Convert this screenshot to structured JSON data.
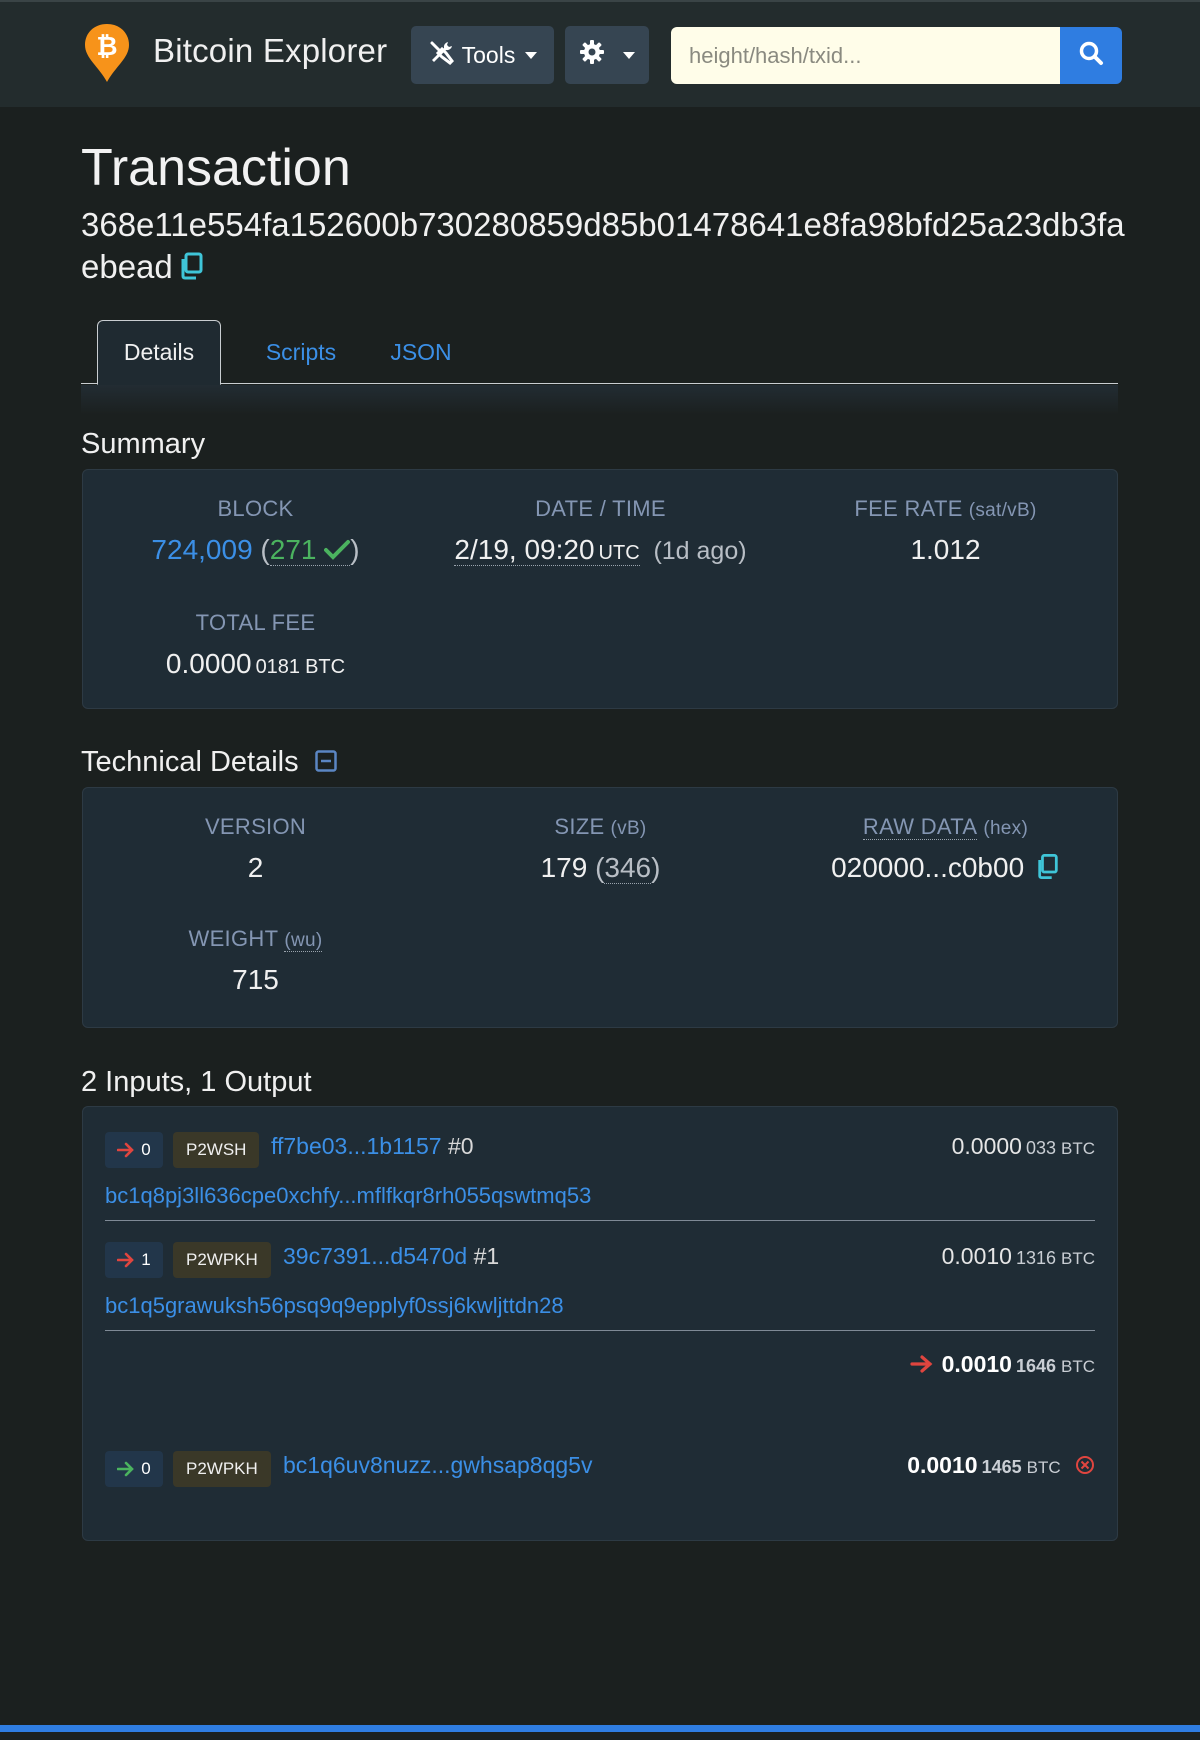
{
  "navbar": {
    "brand": "Bitcoin Explorer",
    "tools_label": "Tools",
    "search_placeholder": "height/hash/txid..."
  },
  "page": {
    "title": "Transaction",
    "txid": "368e11e554fa152600b730280859d85b01478641e8fa98bfd25a23db3faebead"
  },
  "tabs": [
    {
      "label": "Details",
      "active": true
    },
    {
      "label": "Scripts",
      "active": false
    },
    {
      "label": "JSON",
      "active": false
    }
  ],
  "summary": {
    "title": "Summary",
    "block_label": "BLOCK",
    "block_height": "724,009",
    "confirmations": "271",
    "datetime_label": "DATE / TIME",
    "datetime_value": "2/19, 09:20",
    "datetime_tz": "UTC",
    "datetime_ago": "(1d ago)",
    "fee_rate_label": "FEE RATE",
    "fee_rate_unit": "(sat/vB)",
    "fee_rate_value": "1.012",
    "total_fee_label": "TOTAL FEE",
    "total_fee_main": "0.0000",
    "total_fee_small": "0181",
    "total_fee_unit": "BTC"
  },
  "technical": {
    "title": "Technical Details",
    "version_label": "VERSION",
    "version_value": "2",
    "size_label": "SIZE",
    "size_unit": "(vB)",
    "size_value": "179",
    "size_raw": "346",
    "raw_label": "RAW DATA",
    "raw_unit": "(hex)",
    "raw_value": "020000...c0b00",
    "weight_label": "WEIGHT",
    "weight_unit": "(wu)",
    "weight_value": "715"
  },
  "io": {
    "title": "2 Inputs, 1 Output",
    "inputs": [
      {
        "index": "0",
        "type": "P2WSH",
        "prev_tx": "ff7be03...1b1157",
        "prev_index": "#0",
        "amount_main": "0.0000",
        "amount_small": "033",
        "unit": "BTC",
        "address": "bc1q8pj3ll636cpe0xchfy...mflfkqr8rh055qswtmq53"
      },
      {
        "index": "1",
        "type": "P2WPKH",
        "prev_tx": "39c7391...d5470d",
        "prev_index": "#1",
        "amount_main": "0.0010",
        "amount_small": "1316",
        "unit": "BTC",
        "address": "bc1q5grawuksh56psq9q9epplyf0ssj6kwljttdn28"
      }
    ],
    "input_total_main": "0.0010",
    "input_total_small": "1646",
    "input_total_unit": "BTC",
    "outputs": [
      {
        "index": "0",
        "type": "P2WPKH",
        "address": "bc1q6uv8nuzz...gwhsap8qg5v",
        "amount_main": "0.0010",
        "amount_small": "1465",
        "unit": "BTC"
      }
    ]
  },
  "colors": {
    "background": "#1b201f",
    "navbar": "#232c2d",
    "accent": "#2f7de1",
    "link": "#3b8fe6",
    "card": "#1f2c35",
    "bitcoin_orange": "#f7931a",
    "confirm_green": "#4bb35f",
    "arrow_red": "#e0453f"
  },
  "icons": [
    "bitcoin-logo-icon",
    "tools-icon",
    "gear-icon",
    "search-icon",
    "copy-icon",
    "check-icon",
    "collapse-icon",
    "arrow-right-icon",
    "unspent-x-icon"
  ]
}
